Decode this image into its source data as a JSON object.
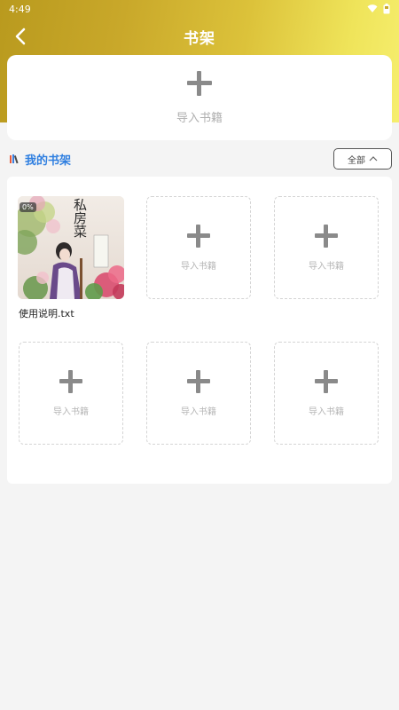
{
  "status_bar": {
    "time": "4:49",
    "icons": [
      "wifi-icon",
      "battery-icon"
    ]
  },
  "nav": {
    "title": "书架",
    "back_icon": "chevron-left-icon"
  },
  "import_card": {
    "icon": "plus-icon",
    "label": "导入书籍"
  },
  "shelf": {
    "title": "我的书架",
    "icon": "books-icon",
    "filter_label": "全部",
    "filter_icon": "chevron-up-icon",
    "accent_color": "#2f7fe0"
  },
  "books": [
    {
      "name": "使用说明.txt",
      "progress": "0%",
      "cover_title": "私房菜"
    }
  ],
  "empty_slots": [
    {
      "label": "导入书籍"
    },
    {
      "label": "导入书籍"
    },
    {
      "label": "导入书籍"
    },
    {
      "label": "导入书籍"
    },
    {
      "label": "导入书籍"
    }
  ]
}
